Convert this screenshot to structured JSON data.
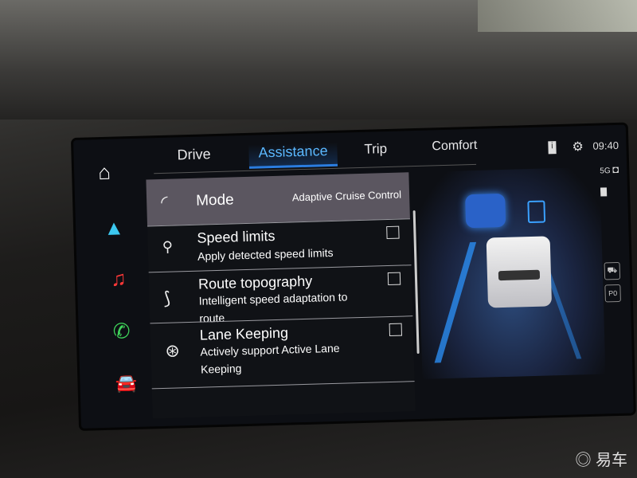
{
  "sidebar": {
    "items": [
      {
        "name": "home",
        "icon": "home-icon"
      },
      {
        "name": "navigation",
        "icon": "navigation-arrow-icon"
      },
      {
        "name": "media",
        "icon": "music-note-icon"
      },
      {
        "name": "phone",
        "icon": "phone-icon"
      },
      {
        "name": "vehicle",
        "icon": "car-icon"
      }
    ]
  },
  "tabs": [
    {
      "label": "Drive",
      "active": false
    },
    {
      "label": "Assistance",
      "active": true
    },
    {
      "label": "Trip",
      "active": false
    },
    {
      "label": "Comfort",
      "active": false
    }
  ],
  "status": {
    "time": "09:40",
    "network": "5G",
    "info_icon": "info-icon",
    "settings_icon": "gear-icon"
  },
  "list": {
    "mode": {
      "label": "Mode",
      "value": "Adaptive Cruise Control",
      "icon": "speedometer-icon"
    },
    "items": [
      {
        "title": "Speed limits",
        "subtitle": "Apply detected speed limits",
        "checked": false,
        "icon": "speed-sign-car-icon"
      },
      {
        "title": "Route topography",
        "subtitle": "Intelligent speed adaptation to route",
        "checked": false,
        "icon": "curvy-road-icon"
      },
      {
        "title": "Lane Keeping",
        "subtitle": "Actively support Active Lane Keeping",
        "checked": false,
        "icon": "steering-wheel-icon"
      }
    ]
  },
  "side_buttons": {
    "top": "⛟",
    "bottom": "P0"
  },
  "colors": {
    "accent": "#2b7de0",
    "active_tab_text": "#5bb8ff",
    "mode_row_bg": "#5b5660"
  },
  "watermark": "易车"
}
